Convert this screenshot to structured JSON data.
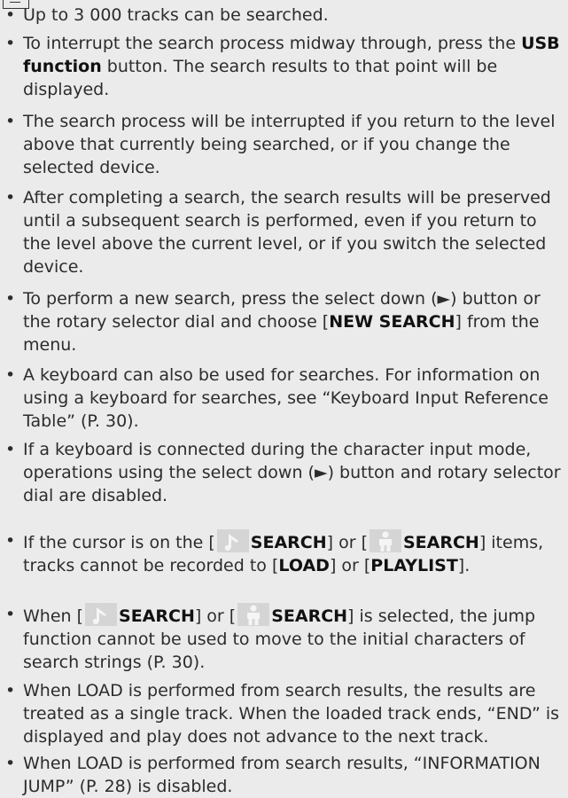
{
  "items": [
    {
      "text": "Up to 3 000 tracks can be searched."
    },
    {
      "pre": "To interrupt the search process midway through, press the ",
      "bold": "USB function",
      "post": " button. The search results to that point will be displayed."
    },
    {
      "text": "The search process will be interrupted if you return to the level above that currently being searched, or if you change the selected device."
    },
    {
      "text": "After completing a search, the search results will be preserved until a subsequent search is performed, even if you return to the level above the current level, or if you switch the selected device."
    },
    {
      "pre": "To perform a new search, press the select down (►) button or the rotary selector dial and choose [",
      "bold": "NEW SEARCH",
      "post": "] from the menu."
    },
    {
      "text": "A keyboard can also be used for searches. For information on using a keyboard for searches, see “Keyboard Input Reference Table” (P. 30)."
    },
    {
      "text": "If a keyboard is connected during the character input mode, operations using the select down (►) button and rotary selector dial are disabled."
    },
    {
      "p1": "If the cursor is on the [",
      "s1": "SEARCH",
      "p2": "] or [",
      "s2": "SEARCH",
      "p3": "] items, tracks cannot be recorded to [",
      "b1": "LOAD",
      "p4": "] or [",
      "b2": "PLAYLIST",
      "p5": "]."
    },
    {
      "p1": "When [",
      "s1": "SEARCH",
      "p2": "] or [",
      "s2": "SEARCH",
      "p3": "] is selected, the jump function cannot be used to move to the initial characters of search strings (P. 30)."
    },
    {
      "text": "When LOAD is performed from search results, the results are treated as a single track. When the loaded track ends, “END” is displayed and play does not advance to the next track."
    },
    {
      "text": "When LOAD is performed from search results, “INFORMATION JUMP” (P. 28) is disabled."
    }
  ],
  "bullet": "•",
  "icons": {
    "note": "music-note-icon",
    "artist": "artist-icon",
    "memo": "note-memo-icon"
  }
}
